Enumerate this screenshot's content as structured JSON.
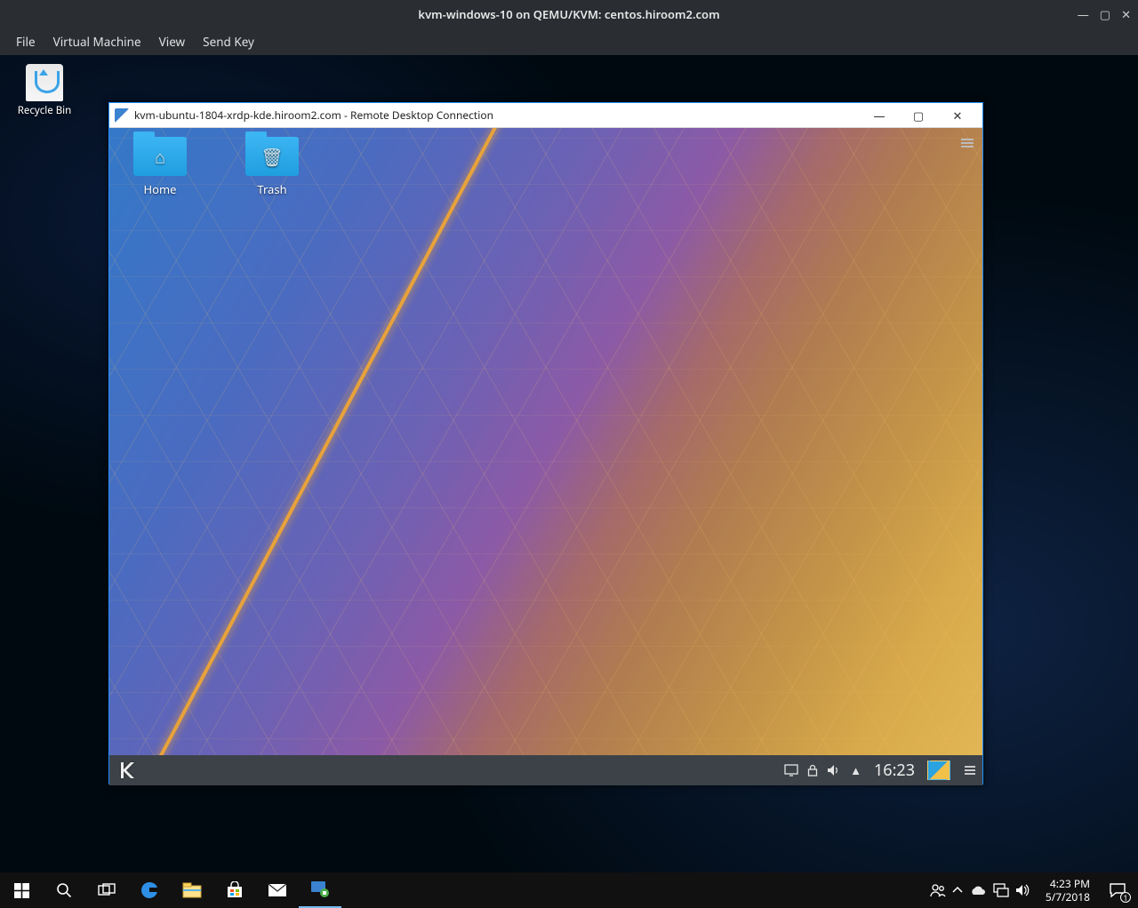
{
  "vm": {
    "title": "kvm-windows-10 on QEMU/KVM: centos.hiroom2.com",
    "menu": [
      "File",
      "Virtual Machine",
      "View",
      "Send Key"
    ]
  },
  "recycle_bin_label": "Recycle Bin",
  "rdp": {
    "title": "kvm-ubuntu-1804-xrdp-kde.hiroom2.com - Remote Desktop Connection"
  },
  "kde": {
    "icons": [
      {
        "label": "Home",
        "glyph": "⌂"
      },
      {
        "label": "Trash",
        "glyph": "🗑"
      }
    ],
    "clock": "16:23"
  },
  "win": {
    "clock_time": "4:23 PM",
    "clock_date": "5/7/2018",
    "notifications": "1"
  }
}
